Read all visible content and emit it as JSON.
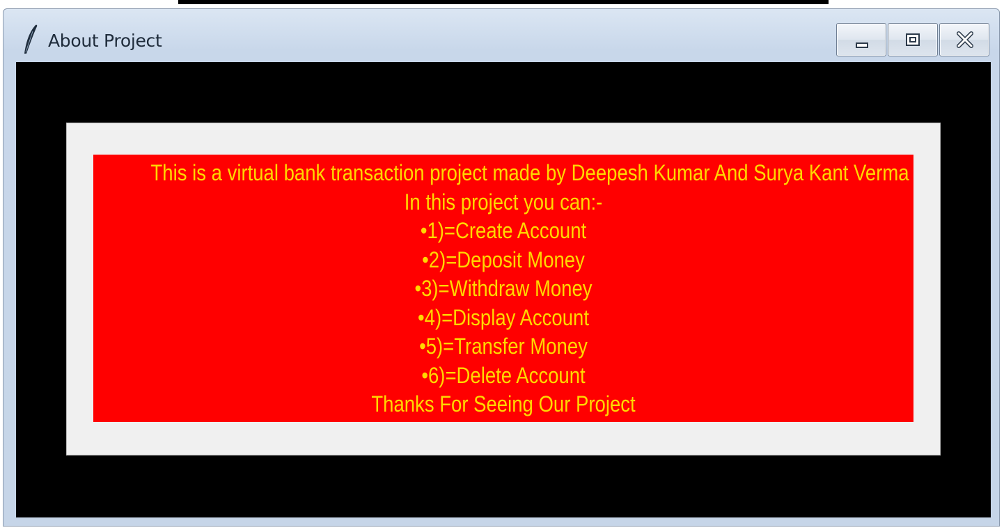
{
  "window": {
    "title": "About Project",
    "icon": "feather-icon",
    "controls": [
      "minimize-icon",
      "maximize-icon",
      "close-icon"
    ]
  },
  "content": {
    "lines": [
      "This is a virtual bank transaction project made by Deepesh Kumar And Surya Kant Verma",
      "In this project you can:-",
      "•1)=Create Account",
      "•2)=Deposit Money",
      "•3)=Withdraw Money",
      "•4)=Display Account",
      "•5)=Transfer Money",
      "•6)=Delete Account",
      "Thanks For Seeing Our Project"
    ]
  },
  "colors": {
    "client_background": "#000000",
    "panel_background": "#f0f0f0",
    "label_background": "#ff0000",
    "label_text": "#ffd800"
  }
}
